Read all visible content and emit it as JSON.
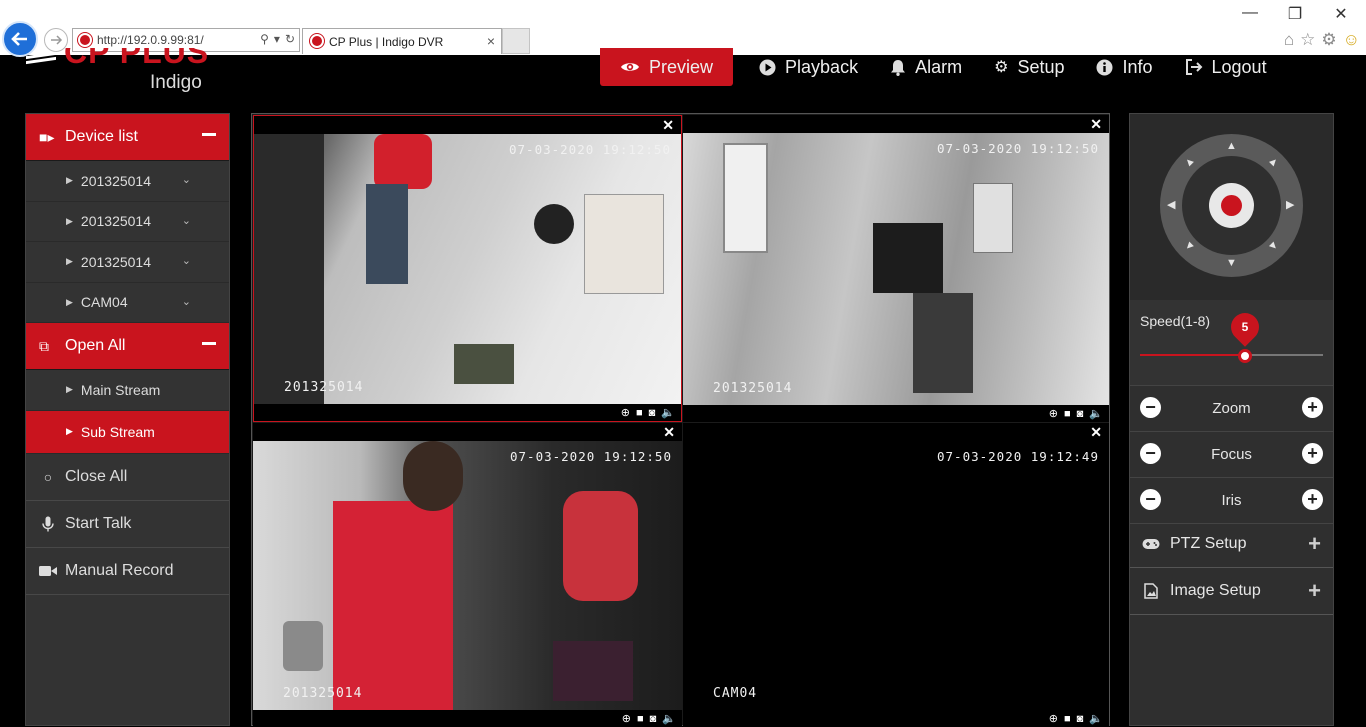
{
  "browser": {
    "url": "http://192.0.9.99:81/",
    "tab_title": "CP Plus | Indigo DVR",
    "tab_close": "×"
  },
  "header": {
    "logo_brand": "CP PLUS",
    "logo_sub": "Indigo",
    "nav": [
      {
        "label": "Preview",
        "icon": "eye-icon",
        "active": true
      },
      {
        "label": "Playback",
        "icon": "play-circle-icon"
      },
      {
        "label": "Alarm",
        "icon": "bell-icon"
      },
      {
        "label": "Setup",
        "icon": "gear-icon"
      },
      {
        "label": "Info",
        "icon": "info-icon"
      },
      {
        "label": "Logout",
        "icon": "logout-icon"
      }
    ]
  },
  "sidebar": {
    "device_list_label": "Device list",
    "devices": [
      {
        "label": "201325014"
      },
      {
        "label": "201325014"
      },
      {
        "label": "201325014"
      },
      {
        "label": "CAM04"
      }
    ],
    "open_all_label": "Open All",
    "streams": [
      {
        "label": "Main Stream",
        "active": false
      },
      {
        "label": "Sub Stream",
        "active": true
      }
    ],
    "close_all_label": "Close All",
    "start_talk_label": "Start Talk",
    "manual_record_label": "Manual Record"
  },
  "cameras": [
    {
      "timestamp": "07-03-2020 19:12:50",
      "name": "201325014",
      "selected": true
    },
    {
      "timestamp": "07-03-2020 19:12:50",
      "name": "201325014",
      "selected": false
    },
    {
      "timestamp": "07-03-2020 19:12:50",
      "name": "201325014",
      "selected": false
    },
    {
      "timestamp": "07-03-2020 19:12:49",
      "name": "CAM04",
      "selected": false
    }
  ],
  "ptz": {
    "speed_label": "Speed(1-8)",
    "speed_value": "5",
    "speed_min": 1,
    "speed_max": 8,
    "zoom_label": "Zoom",
    "focus_label": "Focus",
    "iris_label": "Iris",
    "ptz_setup_label": "PTZ Setup",
    "image_setup_label": "Image Setup"
  },
  "colors": {
    "accent": "#c9141e",
    "panel": "#333333",
    "background": "#000000"
  }
}
